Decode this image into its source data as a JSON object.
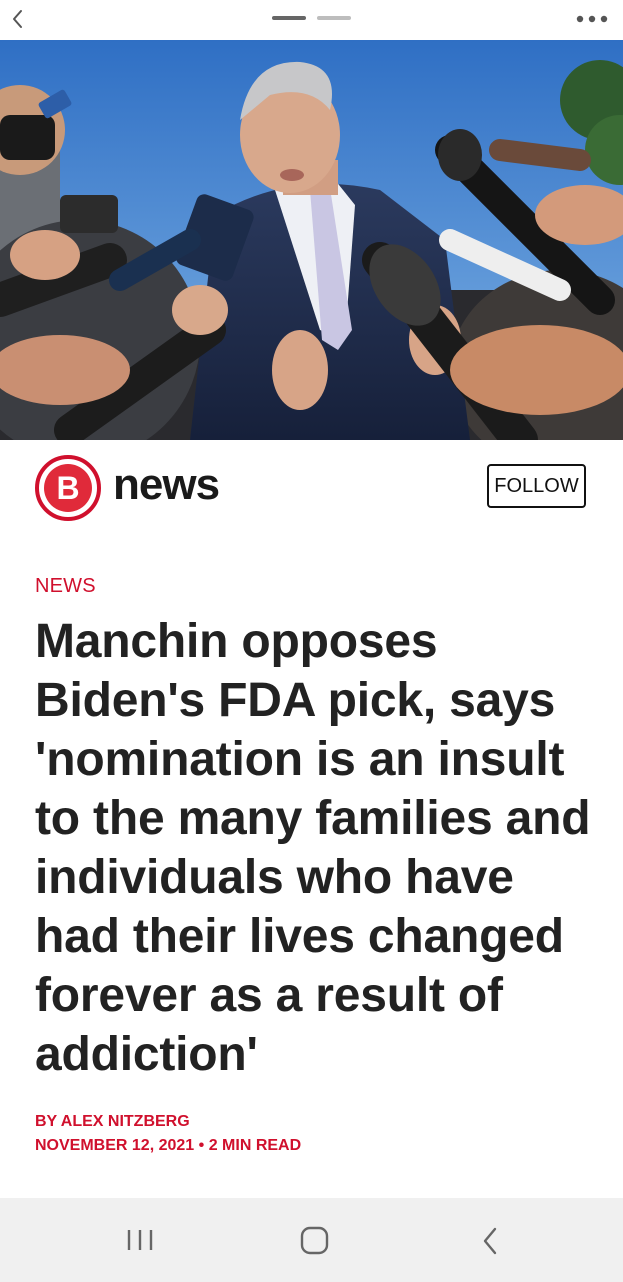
{
  "top_bar": {
    "back_icon": "chevron-left-icon",
    "more_icon": "more-horizontal-icon"
  },
  "hero_image": {
    "description_icon": "press-conference-photo"
  },
  "brand": {
    "logo_letter": "B",
    "name": "news",
    "accent_color": "#d0102d",
    "follow_label": "FOLLOW"
  },
  "article": {
    "section": "NEWS",
    "headline": "Manchin opposes Biden's FDA pick, says 'nomination is an insult to the many families and individuals who have had their lives changed forever as a result of addiction'",
    "author": "BY ALEX NITZBERG",
    "date": "NOVEMBER 12, 2021",
    "separator": "•",
    "read_time": "2 MIN READ"
  },
  "system_nav": {
    "recents_icon": "recents-icon",
    "home_icon": "home-icon",
    "back_icon": "back-icon"
  }
}
